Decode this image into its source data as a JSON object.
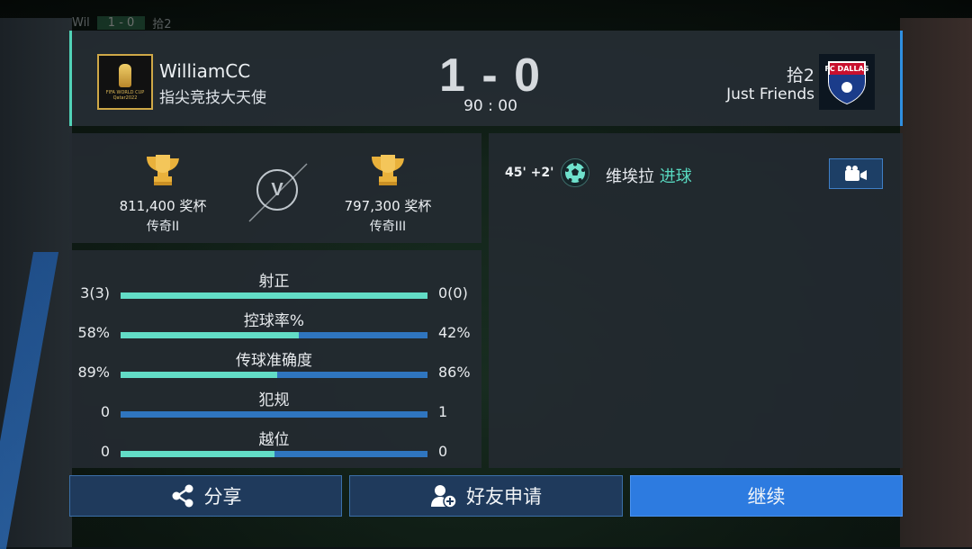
{
  "top_strip": {
    "name": "Wil",
    "score": "1 - 0",
    "away": "拾2"
  },
  "header": {
    "home": {
      "name": "WilliamCC",
      "subtitle": "指尖竞技大天使",
      "badge_text": "FIFA WORLD CUP Qatar2022"
    },
    "score": "1 - 0",
    "clock": "90 : 00",
    "away": {
      "name": "拾2",
      "subtitle": "Just Friends",
      "badge_text": "FC DALLAS"
    }
  },
  "trophies": {
    "home": {
      "points": "811,400 奖杯",
      "rank": "传奇II"
    },
    "vs": "V",
    "away": {
      "points": "797,300 奖杯",
      "rank": "传奇III"
    }
  },
  "stats": [
    {
      "label": "射正",
      "left": "3(3)",
      "right": "0(0)",
      "home_fraction": 1.0
    },
    {
      "label": "控球率%",
      "left": "58%",
      "right": "42%",
      "home_fraction": 0.58
    },
    {
      "label": "传球准确度",
      "left": "89%",
      "right": "86%",
      "home_fraction": 0.51
    },
    {
      "label": "犯规",
      "left": "0",
      "right": "1",
      "home_fraction": 0.0
    },
    {
      "label": "越位",
      "left": "0",
      "right": "0",
      "home_fraction": 0.5
    }
  ],
  "events": [
    {
      "time": "45' +2'",
      "player": "维埃拉",
      "type": "进球",
      "icon": "soccer-ball-icon"
    }
  ],
  "buttons": {
    "share": "分享",
    "friend_request": "好友申请",
    "continue": "继续"
  },
  "colors": {
    "home_accent": "#62dcc6",
    "away_accent": "#2f75bf",
    "continue_button": "#2d7be0"
  }
}
